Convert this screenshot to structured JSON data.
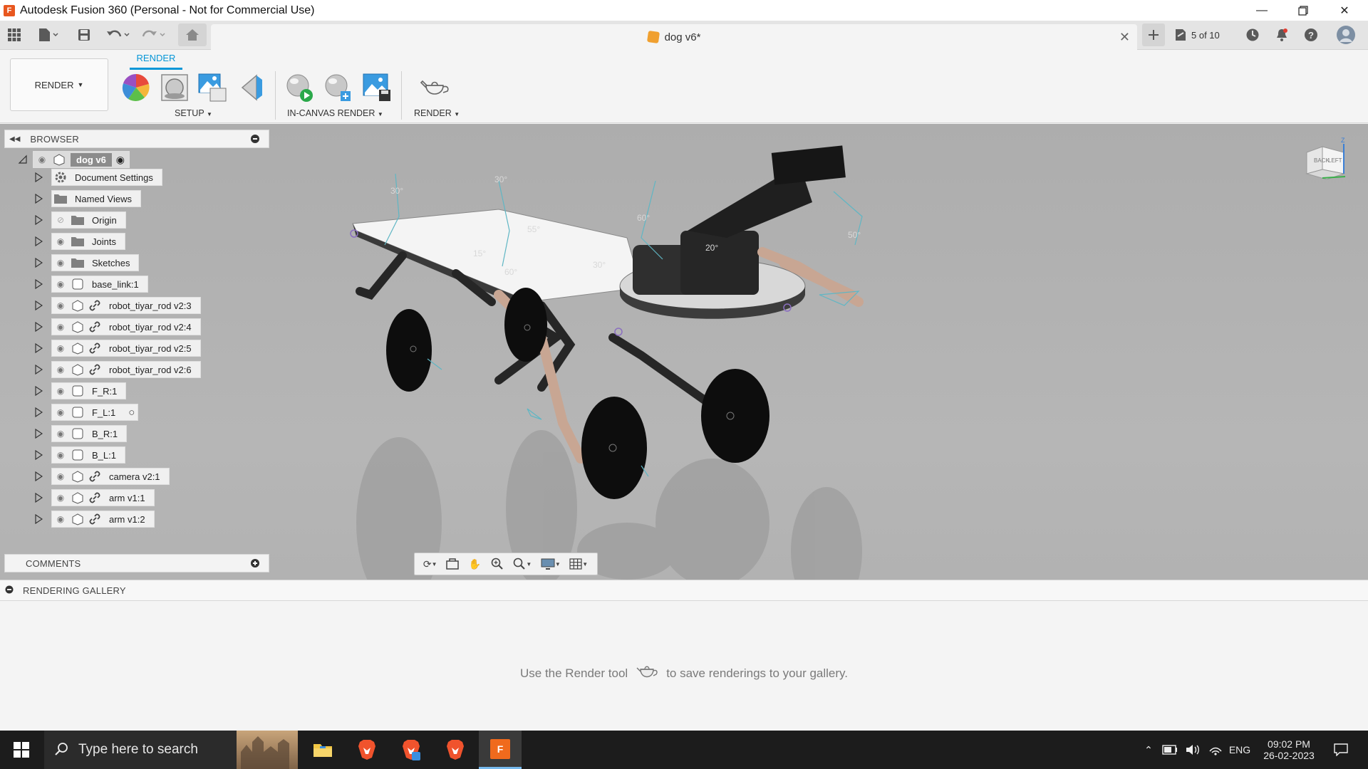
{
  "window": {
    "title": "Autodesk Fusion 360 (Personal - Not for Commercial Use)"
  },
  "toolbar": {
    "doc_tab": "dog v6*",
    "version": "5 of 10"
  },
  "ribbon": {
    "workspace": "RENDER",
    "tab": "RENDER",
    "groups": [
      "SETUP",
      "IN-CANVAS RENDER",
      "RENDER"
    ]
  },
  "browser": {
    "title": "BROWSER",
    "root": "dog v6",
    "items": [
      "Document Settings",
      "Named Views",
      "Origin",
      "Joints",
      "Sketches",
      "base_link:1",
      "robot_tiyar_rod v2:3",
      "robot_tiyar_rod v2:4",
      "robot_tiyar_rod v2:5",
      "robot_tiyar_rod v2:6",
      "F_R:1",
      "F_L:1",
      "B_R:1",
      "B_L:1",
      "camera v2:1",
      "arm v1:1",
      "arm v1:2"
    ]
  },
  "comments": {
    "title": "COMMENTS"
  },
  "viewport": {
    "angles": [
      "30°",
      "30°",
      "55°",
      "60°",
      "30°",
      "60°",
      "15°",
      "20°",
      "50°"
    ],
    "viewcube": {
      "back": "BACK",
      "left": "LEFT",
      "axis": "Z"
    }
  },
  "gallery": {
    "title": "RENDERING GALLERY",
    "msg_before": "Use the Render tool",
    "msg_after": "to save renderings to your gallery."
  },
  "taskbar": {
    "search_placeholder": "Type here to search",
    "lang": "ENG",
    "time": "09:02 PM",
    "date": "26-02-2023"
  }
}
